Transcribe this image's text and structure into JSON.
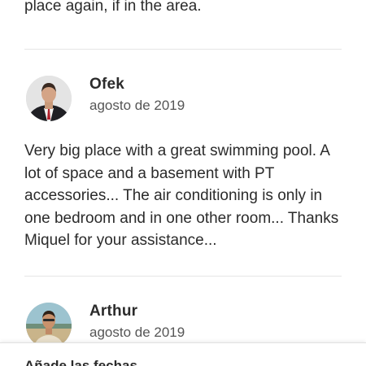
{
  "previous_review": {
    "tail_text": "place again, if in the area."
  },
  "reviews": [
    {
      "name": "Ofek",
      "date": "agosto de 2019",
      "body": "Very big place with a great swimming pool. A lot of space and a basement with PT accessories... The air conditioning is only in one bedroom and in one other room... Thanks Miquel for your assistance..."
    },
    {
      "name": "Arthur",
      "date": "agosto de 2019"
    }
  ],
  "bottom_bar": {
    "label": "Añade las fechas"
  },
  "colors": {
    "text": "#2b2b2b",
    "secondary_text": "#555555",
    "divider": "#e6e6e6",
    "background": "#ffffff"
  }
}
